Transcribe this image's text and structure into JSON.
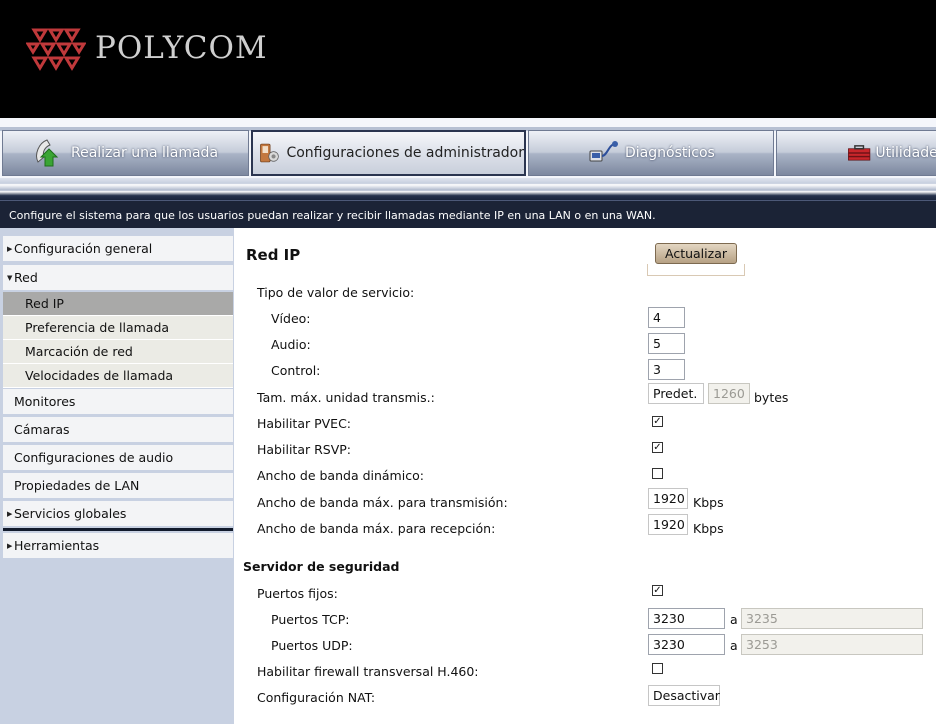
{
  "header": {
    "brand": "POLYCOM"
  },
  "tabs": [
    {
      "label": "Realizar una llamada",
      "icon": "phone-icon"
    },
    {
      "label": "Configuraciones de administrador",
      "icon": "admin-tools-icon"
    },
    {
      "label": "Diagnósticos",
      "icon": "diagnostics-icon"
    },
    {
      "label": "Utilidades",
      "icon": "toolbox-icon"
    }
  ],
  "description": "Configure el sistema para que los usuarios puedan realizar y recibir llamadas mediante IP en una LAN o en una WAN.",
  "sidebar": {
    "items": [
      {
        "label": "Configuración general"
      },
      {
        "label": "Red"
      },
      {
        "label": "Red IP"
      },
      {
        "label": "Preferencia de llamada"
      },
      {
        "label": "Marcación de red"
      },
      {
        "label": "Velocidades de llamada"
      },
      {
        "label": "Monitores"
      },
      {
        "label": "Cámaras"
      },
      {
        "label": "Configuraciones de audio"
      },
      {
        "label": "Propiedades de LAN"
      },
      {
        "label": "Servicios globales"
      },
      {
        "label": "Herramientas"
      }
    ]
  },
  "main": {
    "title": "Red IP",
    "update_button": "Actualizar",
    "qos": {
      "label": "Tipo de valor de servicio:",
      "video_label": "Vídeo:",
      "video_value": "4",
      "audio_label": "Audio:",
      "audio_value": "5",
      "control_label": "Control:",
      "control_value": "3"
    },
    "mtu": {
      "label": "Tam. máx. unidad transmis.:",
      "mode": "Predet.",
      "value": "1260",
      "unit": "bytes"
    },
    "pvec": {
      "label": "Habilitar PVEC:",
      "checked": true
    },
    "rsvp": {
      "label": "Habilitar RSVP:",
      "checked": true
    },
    "dynamic_bw": {
      "label": "Ancho de banda dinámico:",
      "checked": false
    },
    "max_tx": {
      "label": "Ancho de banda máx. para transmisión:",
      "value": "1920",
      "unit": "Kbps"
    },
    "max_rx": {
      "label": "Ancho de banda máx. para recepción:",
      "value": "1920",
      "unit": "Kbps"
    },
    "security": {
      "title": "Servidor de seguridad",
      "fixed_ports": {
        "label": "Puertos fijos:",
        "checked": true
      },
      "tcp": {
        "label": "Puertos TCP:",
        "from": "3230",
        "sep": "a",
        "to": "3235"
      },
      "udp": {
        "label": "Puertos UDP:",
        "from": "3230",
        "sep": "a",
        "to": "3253"
      },
      "h460": {
        "label": "Habilitar firewall transversal H.460:",
        "checked": false
      },
      "nat": {
        "label": "Configuración NAT:",
        "value": "Desactivar"
      }
    }
  },
  "check_mark": "✓"
}
